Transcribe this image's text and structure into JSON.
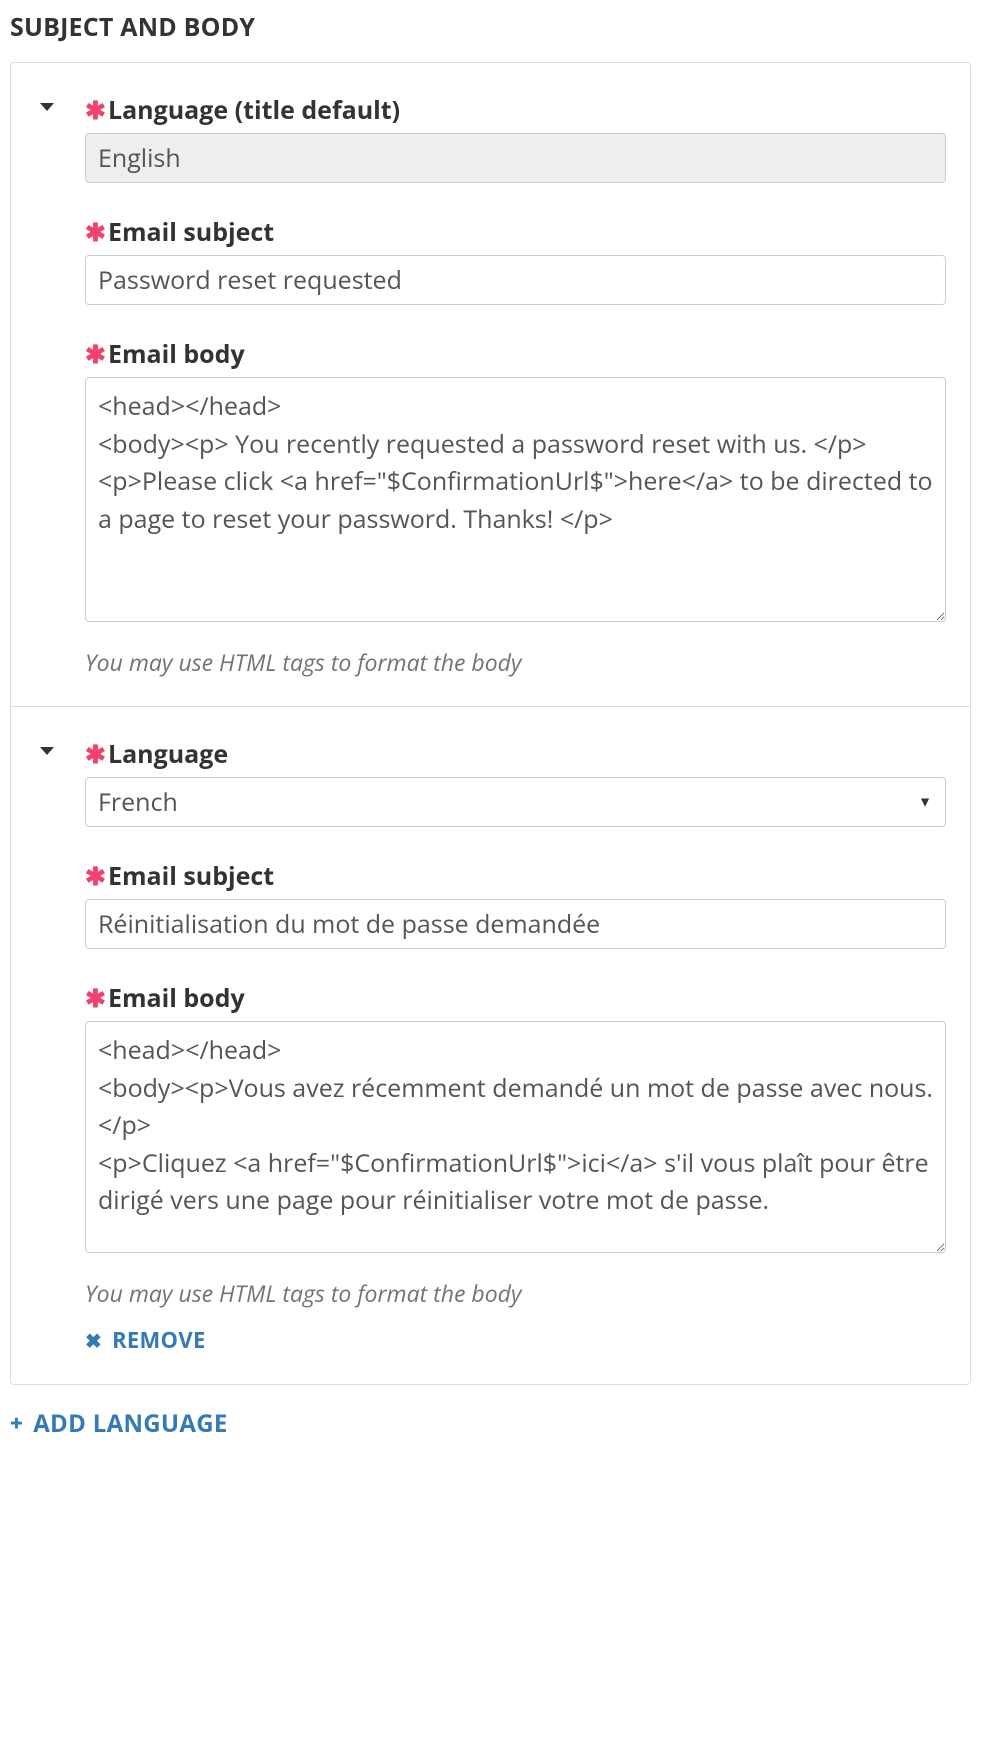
{
  "section": {
    "heading": "SUBJECT AND BODY"
  },
  "blocks": [
    {
      "language_label": "Language (title default)",
      "language_value": "English",
      "language_readonly": true,
      "subject_label": "Email subject",
      "subject_value": "Password reset requested",
      "body_label": "Email body",
      "body_value": "<head></head>\n<body><p> You recently requested a password reset with us. </p>\n<p>Please click <a href=\"$ConfirmationUrl$\">here</a> to be directed to a page to reset your password. Thanks! </p>",
      "help_text": "You may use HTML tags to format the body",
      "removable": false
    },
    {
      "language_label": "Language",
      "language_value": "French",
      "language_readonly": false,
      "subject_label": "Email subject",
      "subject_value": "Réinitialisation du mot de passe demandée",
      "body_label": "Email body",
      "body_value": "<head></head>\n<body><p>Vous avez récemment demandé un mot de passe avec nous. </p>\n<p>Cliquez <a href=\"$ConfirmationUrl$\">ici</a> s'il vous plaît pour être dirigé vers une page pour réinitialiser votre mot de passe.",
      "help_text": "You may use HTML tags to format the body",
      "removable": true
    }
  ],
  "actions": {
    "remove_label": "REMOVE",
    "add_language_label": "ADD LANGUAGE"
  }
}
